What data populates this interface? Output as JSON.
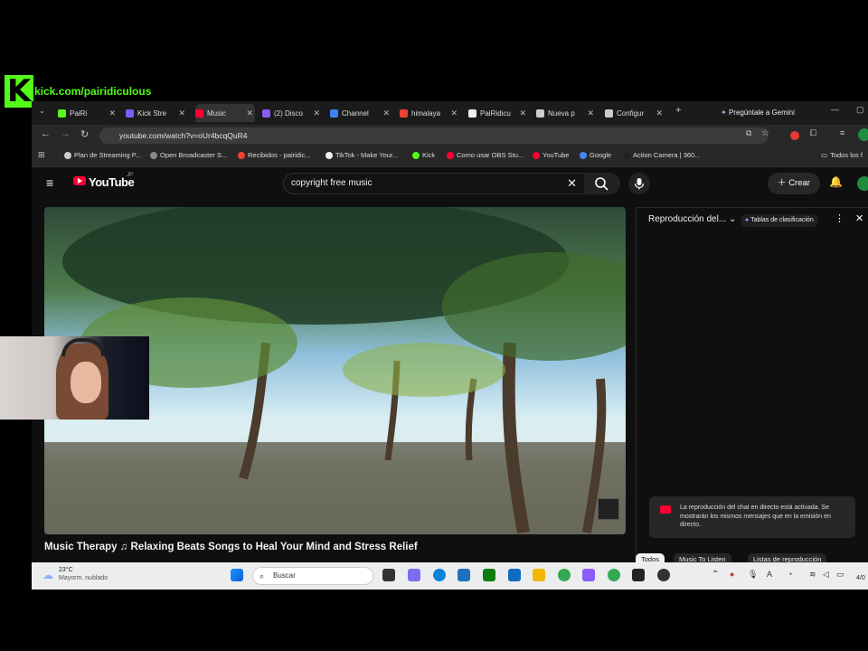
{
  "overlay": {
    "kick_logo": "K",
    "kick_url": "kick.com/pairidiculous"
  },
  "tabs": [
    {
      "label": "PaiRi",
      "icon": "kick-favicon",
      "color": "#53fc18"
    },
    {
      "label": "Kick Stre",
      "icon": "kick-studio-favicon",
      "color": "#7c5cff"
    },
    {
      "label": "Music",
      "icon": "youtube-favicon",
      "color": "#ff0033"
    },
    {
      "label": "(2) Disco",
      "icon": "discord-favicon",
      "color": "#8b5cf6"
    },
    {
      "label": "Channel",
      "icon": "channel-favicon",
      "color": "#3b82f6"
    },
    {
      "label": "himalaya",
      "icon": "google-favicon",
      "color": "#ea4335"
    },
    {
      "label": "PaiRidicu",
      "icon": "tiktok-favicon",
      "color": "#eeeeee"
    },
    {
      "label": "Nueva p",
      "icon": "globe-favicon",
      "color": "#cccccc"
    },
    {
      "label": "Configur",
      "icon": "gear-favicon",
      "color": "#cccccc"
    }
  ],
  "browser": {
    "gemini_label": "Pregúntale a Gemini",
    "url": "youtube.com/watch?v=oUr4bcqQuR4",
    "bookmarks": [
      {
        "label": "Plan de Streaming P...",
        "color": "#cccccc"
      },
      {
        "label": "Open Broadcaster S...",
        "color": "#888888"
      },
      {
        "label": "Recibidos - pairidic...",
        "color": "#ea4335"
      },
      {
        "label": "TikTok - Make Your...",
        "color": "#eeeeee"
      },
      {
        "label": "Kick",
        "color": "#53fc18"
      },
      {
        "label": "Como usar OBS Stu...",
        "color": "#ff0033"
      },
      {
        "label": "YouTube",
        "color": "#ff0033"
      },
      {
        "label": "Google",
        "color": "#4285f4"
      },
      {
        "label": "Action Camera | 360...",
        "color": "#222222"
      }
    ],
    "all_bookmarks": "Todos los f"
  },
  "youtube": {
    "logo_text": "YouTube",
    "country": "JP",
    "search_value": "copyright free music",
    "create_label": "Crear",
    "video_title": "Music Therapy ♫ Relaxing Beats Songs to Heal Your Mind and Stress Relief",
    "chat": {
      "header": "Reproducción del...",
      "chip": "Tablas de clasificación",
      "banner": "La reproducción del chat en directo está activada. Se mostrarán los mismos mensajes que en la emisión en directo."
    },
    "chips": [
      "Todos",
      "Music To Listen",
      "Listas de reproducción"
    ]
  },
  "taskbar": {
    "temp": "23°C",
    "weather": "Mayorm. nublado",
    "search_placeholder": "Buscar",
    "clock": "4/0"
  }
}
